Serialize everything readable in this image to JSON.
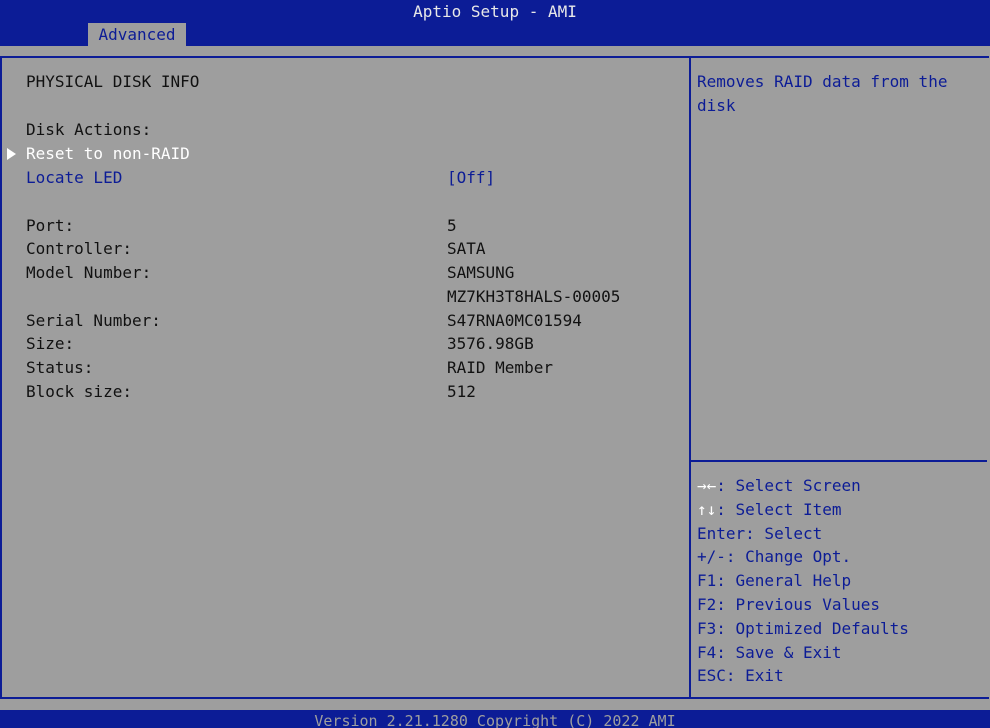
{
  "header": {
    "title": "Aptio Setup - AMI",
    "active_tab": "Advanced"
  },
  "main": {
    "section_title": "PHYSICAL DISK INFO",
    "disk_actions_label": "Disk Actions:",
    "reset_item": "Reset to non-RAID",
    "locate_led_label": "Locate LED",
    "locate_led_value": "[Off]",
    "info": [
      {
        "label": "Port:",
        "value": "5"
      },
      {
        "label": "Controller:",
        "value": "SATA"
      },
      {
        "label": "Model Number:",
        "value": "SAMSUNG"
      },
      {
        "label": "",
        "value": "MZ7KH3T8HALS-00005"
      },
      {
        "label": "Serial Number:",
        "value": "S47RNA0MC01594"
      },
      {
        "label": "Size:",
        "value": "3576.98GB"
      },
      {
        "label": "Status:",
        "value": "RAID Member"
      },
      {
        "label": "Block size:",
        "value": "512"
      }
    ]
  },
  "help": {
    "text": "Removes RAID data from the disk"
  },
  "keys": [
    {
      "key": "→←",
      "desc": ": Select Screen"
    },
    {
      "key": "↑↓",
      "desc": ": Select Item"
    },
    {
      "key": "",
      "desc": "Enter: Select"
    },
    {
      "key": "",
      "desc": "+/-: Change Opt."
    },
    {
      "key": "",
      "desc": "F1: General Help"
    },
    {
      "key": "",
      "desc": "F2: Previous Values"
    },
    {
      "key": "",
      "desc": "F3: Optimized Defaults"
    },
    {
      "key": "",
      "desc": "F4: Save & Exit"
    },
    {
      "key": "",
      "desc": "ESC: Exit"
    }
  ],
  "footer": {
    "version": "Version 2.21.1280 Copyright (C) 2022 AMI"
  },
  "colors": {
    "primary": "#0c1c96",
    "background": "#9e9e9e",
    "highlight": "#ffffff"
  }
}
